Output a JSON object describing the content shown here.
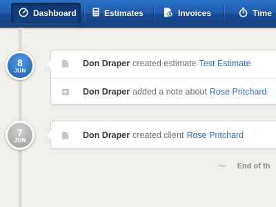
{
  "nav": {
    "tabs": [
      {
        "label": "Dashboard",
        "icon": "dashboard-icon",
        "active": true
      },
      {
        "label": "Estimates",
        "icon": "calculator-icon",
        "active": false
      },
      {
        "label": "Invoices",
        "icon": "invoice-icon",
        "active": false
      },
      {
        "label": "Time",
        "icon": "stopwatch-icon",
        "active": false
      }
    ]
  },
  "timeline": {
    "groups": [
      {
        "day": "8",
        "month": "JUN",
        "badge_color": "#1d5fb4",
        "entries": [
          {
            "icon": "document-icon",
            "actor": "Don Draper",
            "verb": "created estimate",
            "target": "Test Estimate"
          },
          {
            "icon": "note-icon",
            "actor": "Don Draper",
            "verb": "added a note about",
            "target": "Rose Pritchard"
          }
        ]
      },
      {
        "day": "7",
        "month": "JUN",
        "badge_color": "#9b9b9b",
        "entries": [
          {
            "icon": "document-icon",
            "actor": "Don Draper",
            "verb": "created client",
            "target": "Rose Pritchard"
          }
        ]
      }
    ],
    "end_label": "End of th"
  },
  "colors": {
    "nav_blue": "#1e5bae",
    "link_blue": "#2a6fc4",
    "background": "#f0efea"
  }
}
